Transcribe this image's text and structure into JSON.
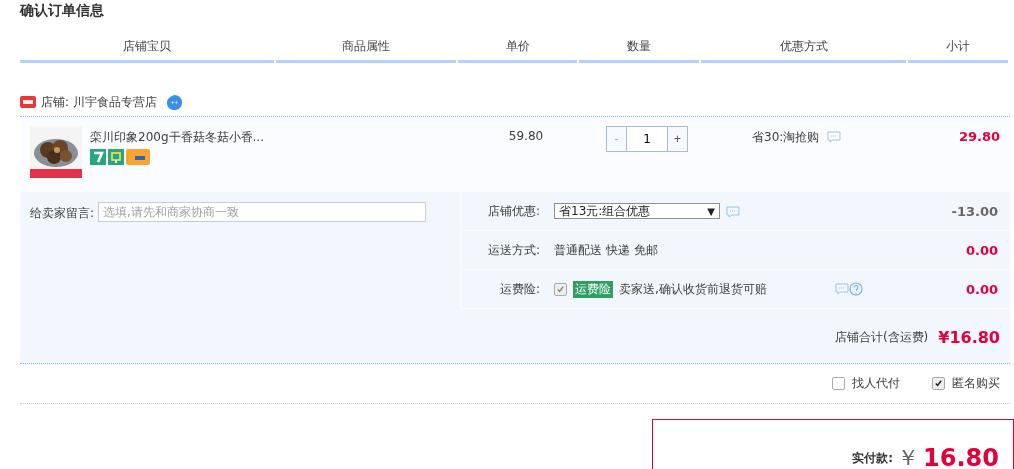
{
  "page_title": "确认订单信息",
  "columns": [
    "店铺宝贝",
    "商品属性",
    "单价",
    "数量",
    "优惠方式",
    "小计"
  ],
  "shop": {
    "label": "店铺: 川宇食品专营店"
  },
  "item": {
    "name": "栾川印象200g干香菇冬菇小香...",
    "price": "59.80",
    "quantity": "1",
    "minus": "-",
    "plus": "+",
    "discount": "省30:淘抢购",
    "subtotal": "29.80"
  },
  "message": {
    "label": "给卖家留言:",
    "placeholder": "选填,请先和商家协商一致"
  },
  "promo_rows": [
    {
      "kind": "select",
      "label": "店铺优惠:",
      "value": "省13元:组合优惠",
      "arrow": "▼",
      "amount": "-13.00",
      "negative": true
    },
    {
      "kind": "text",
      "label": "运送方式:",
      "value": "普通配送 快递 免邮",
      "amount": "0.00",
      "negative": false
    },
    {
      "kind": "insurance",
      "label": "运费险:",
      "checked": true,
      "tag": "运费险",
      "value": "卖家送,确认收货前退货可赔",
      "amount": "0.00",
      "negative": false
    }
  ],
  "shop_total": {
    "label": "店铺合计(含运费)",
    "amount": "¥16.80"
  },
  "options": [
    {
      "label": "找人代付",
      "checked": false
    },
    {
      "label": "匿名购买",
      "checked": true
    }
  ],
  "payment": {
    "label": "实付款:",
    "currency": "￥",
    "amount": "16.80"
  }
}
